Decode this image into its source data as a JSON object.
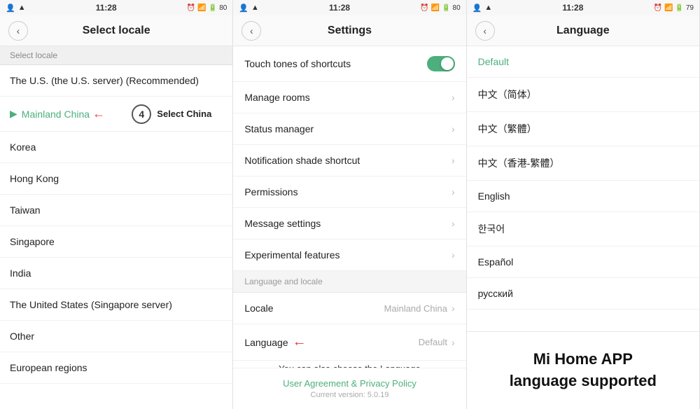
{
  "panel1": {
    "status": {
      "time": "11:28",
      "battery": "80"
    },
    "header_title": "Select locale",
    "subheader": "Select locale",
    "items": [
      {
        "id": "us",
        "label": "The U.S. (the U.S. server) (Recommended)",
        "selected": false
      },
      {
        "id": "china",
        "label": "Mainland China",
        "selected": true
      },
      {
        "id": "korea",
        "label": "Korea",
        "selected": false
      },
      {
        "id": "hongkong",
        "label": "Hong Kong",
        "selected": false
      },
      {
        "id": "taiwan",
        "label": "Taiwan",
        "selected": false
      },
      {
        "id": "singapore",
        "label": "Singapore",
        "selected": false
      },
      {
        "id": "india",
        "label": "India",
        "selected": false
      },
      {
        "id": "us_sg",
        "label": "The United States (Singapore server)",
        "selected": false
      },
      {
        "id": "other",
        "label": "Other",
        "selected": false
      },
      {
        "id": "europe",
        "label": "European regions",
        "selected": false
      }
    ],
    "annotation_num": "4",
    "annotation_text": "Select China"
  },
  "panel2": {
    "status": {
      "time": "11:28",
      "battery": "80"
    },
    "header_title": "Settings",
    "items": [
      {
        "id": "touch",
        "label": "Touch tones of shortcuts",
        "type": "toggle",
        "value": true,
        "right_text": ""
      },
      {
        "id": "rooms",
        "label": "Manage rooms",
        "type": "chevron",
        "right_text": ""
      },
      {
        "id": "status",
        "label": "Status manager",
        "type": "chevron",
        "right_text": ""
      },
      {
        "id": "notification",
        "label": "Notification shade shortcut",
        "type": "chevron",
        "right_text": ""
      },
      {
        "id": "permissions",
        "label": "Permissions",
        "type": "chevron",
        "right_text": ""
      },
      {
        "id": "message",
        "label": "Message settings",
        "type": "chevron",
        "right_text": ""
      },
      {
        "id": "experimental",
        "label": "Experimental features",
        "type": "chevron",
        "right_text": ""
      }
    ],
    "section_header": "Language and locale",
    "locale_item": {
      "label": "Locale",
      "value": "Mainland China"
    },
    "language_item": {
      "label": "Language",
      "value": "Default"
    },
    "annotation_text": "You can also choose the Language",
    "footer_link": "User Agreement & Privacy Policy",
    "footer_version": "Current version: 5.0.19"
  },
  "panel3": {
    "status": {
      "time": "11:28",
      "battery": "79"
    },
    "header_title": "Language",
    "items": [
      {
        "id": "default",
        "label": "Default",
        "selected": true
      },
      {
        "id": "zh_cn",
        "label": "中文（简体）",
        "selected": false
      },
      {
        "id": "zh_tw",
        "label": "中文（繁體）",
        "selected": false
      },
      {
        "id": "zh_hk",
        "label": "中文（香港-繁體）",
        "selected": false
      },
      {
        "id": "en",
        "label": "English",
        "selected": false
      },
      {
        "id": "ko",
        "label": "한국어",
        "selected": false
      },
      {
        "id": "es",
        "label": "Español",
        "selected": false
      },
      {
        "id": "ru",
        "label": "русский",
        "selected": false
      }
    ],
    "footer_line1": "Mi Home APP",
    "footer_line2": "language supported"
  }
}
